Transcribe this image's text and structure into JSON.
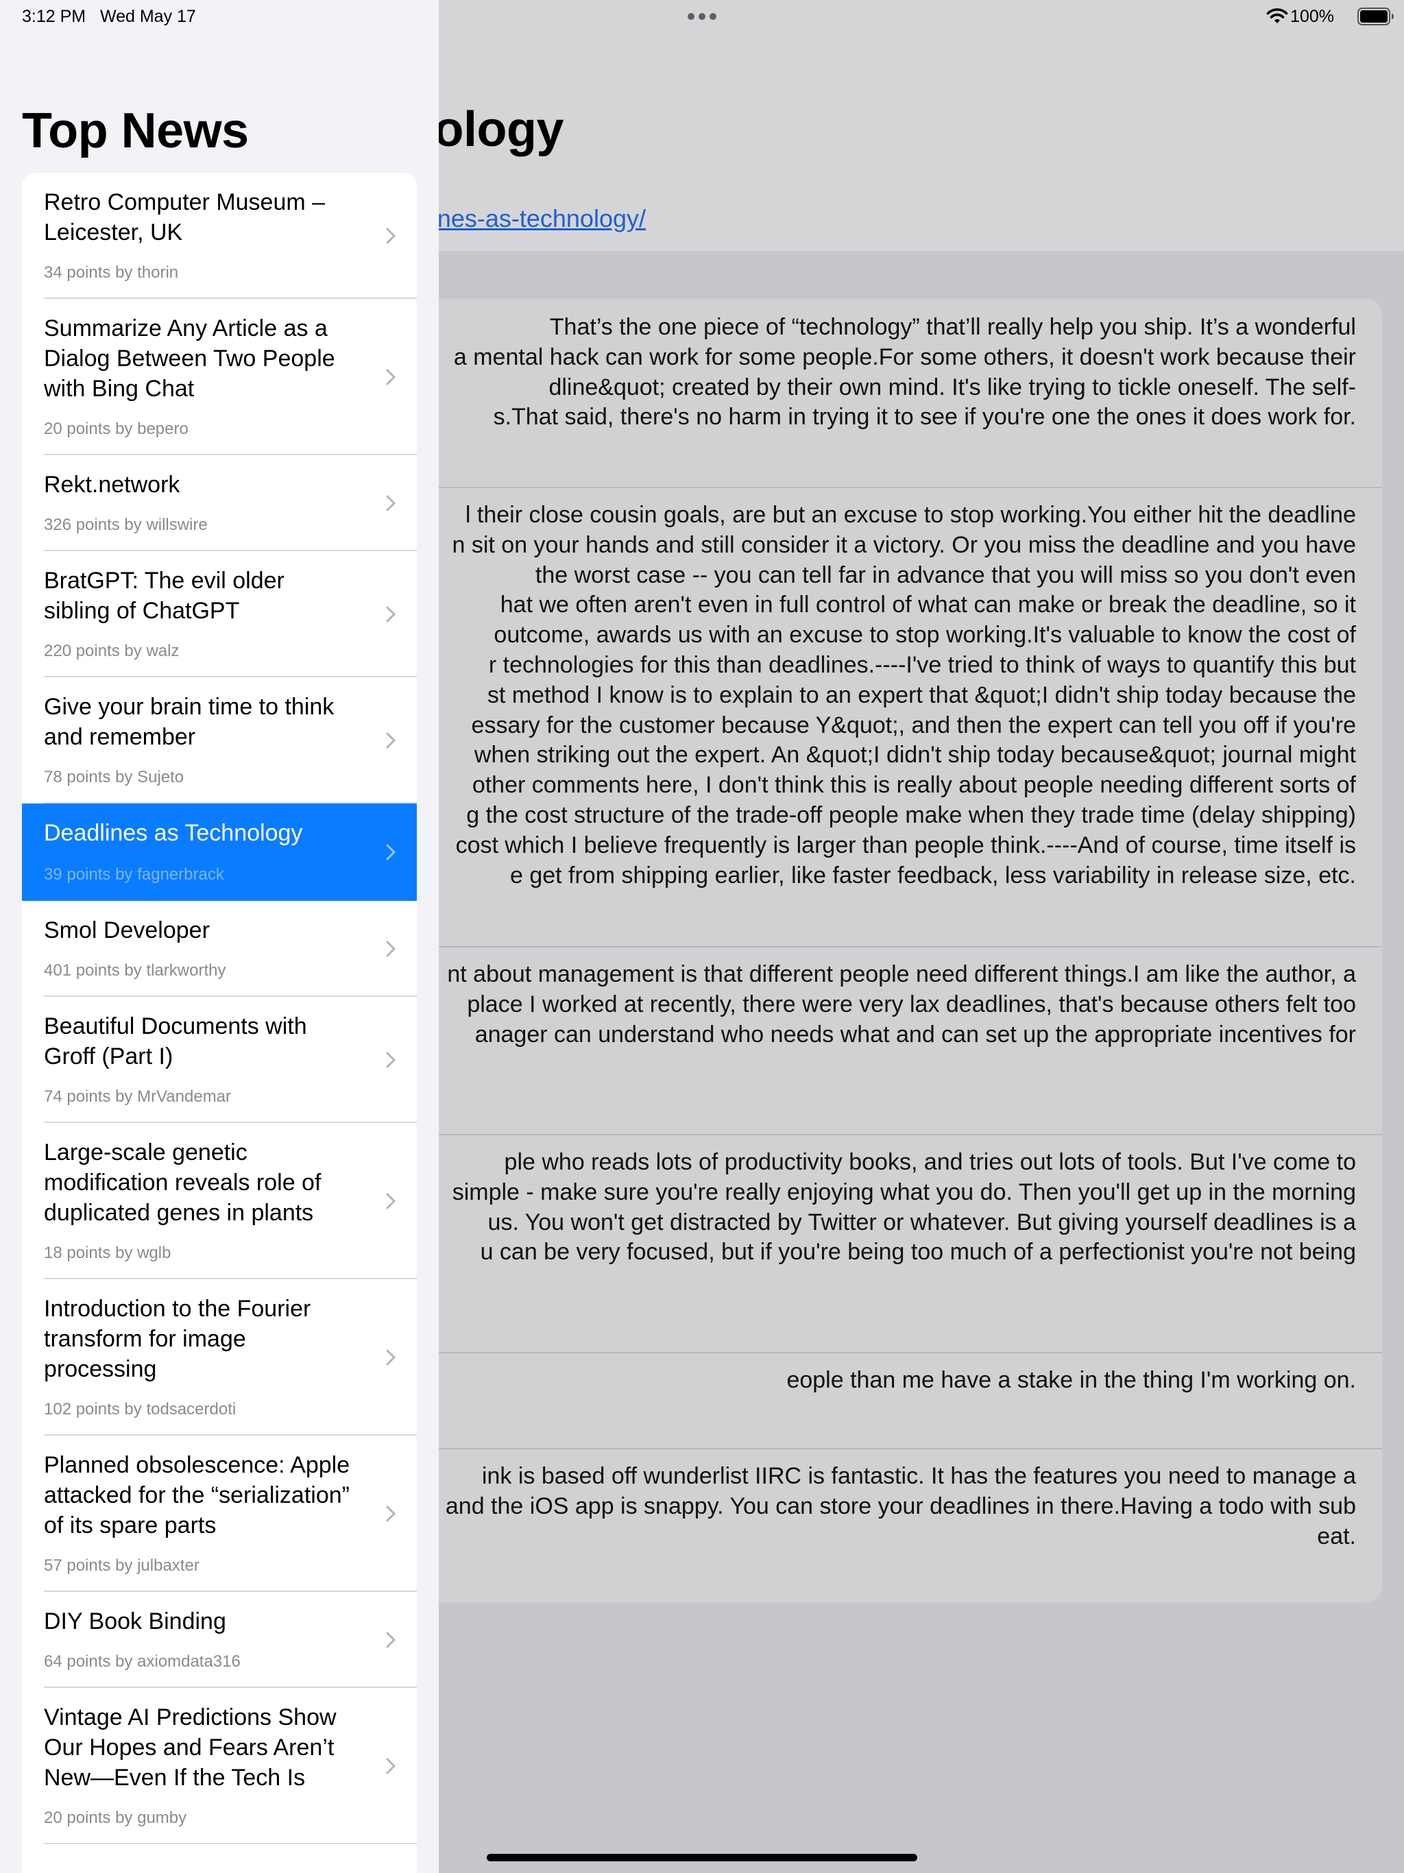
{
  "status_bar": {
    "time": "3:12 PM",
    "date": "Wed May 17",
    "battery": "100%",
    "icons": [
      "more-dots-icon",
      "wifi-icon",
      "battery-icon"
    ]
  },
  "detail": {
    "title_partial": "nology",
    "link_partial": "ines-as-technology/",
    "comments": [
      {
        "lines": [
          "That’s the one piece of “technology” that’ll really help you ship. It’s a wonderful",
          "a mental hack can work for some people.For some others, it doesn't work because their",
          "dline&quot; created by their own mind.  It's like trying to tickle oneself.  The self-",
          "s.That said, there's no harm in trying it to see if you're one the ones it does work for."
        ]
      },
      {
        "lines": [
          "l their close cousin goals, are but an excuse to stop working.You either hit the deadline",
          "n sit on your hands and still consider it a victory. Or you miss the deadline and you have",
          "the worst case -- you can tell far in advance that you will miss so you don't even",
          "hat we often aren't even in full control of what can make or break the deadline, so it",
          "outcome, awards us with an excuse to stop working.It's valuable to know the cost of",
          "r technologies for this than deadlines.----I've tried to think of ways to quantify this but",
          "st method I know is to explain to an expert that &quot;I didn't ship today because the",
          "essary for the customer because Y&quot;, and then the expert can tell you off if you're",
          "when striking out the expert. An &quot;I didn't ship today because&quot; journal might",
          "other comments here, I don't think this is really about people needing different sorts of",
          "g the cost structure of the trade-off people make when they trade time (delay shipping)",
          "cost which I believe frequently is larger than people think.----And of course, time itself is",
          "e get from shipping earlier, like faster feedback, less variability in release size, etc."
        ]
      },
      {
        "lines": [
          "nt about management is that different people need different things.I am like the author, a",
          "place I worked at recently, there were very lax deadlines, that's because others felt too",
          "anager can understand who needs what and can set up the appropriate incentives for"
        ]
      },
      {
        "lines": [
          "ple who reads lots of productivity books, and tries out lots of tools. But I've come to",
          "simple - make sure you're really enjoying what you do. Then you'll get up in the morning",
          "us. You won't get distracted by Twitter or whatever. But giving yourself deadlines is a",
          "u can be very focused, but if you're being too much of a perfectionist you're not being"
        ]
      },
      {
        "lines": [
          "eople than me have a stake in the thing I'm working on."
        ]
      },
      {
        "lines": [
          "ink is based off wunderlist IIRC is fantastic. It has the features you need to manage a",
          "and the iOS app is snappy. You can store your deadlines in there.Having a todo with sub",
          "eat."
        ]
      }
    ]
  },
  "sidebar": {
    "title": "Top News",
    "selected_index": 5,
    "accent_color": "#0a7cff",
    "items": [
      {
        "title": "Retro Computer Museum – Leicester, UK",
        "meta": "34 points by thorin"
      },
      {
        "title": "Summarize Any Article as a Dialog Between Two People with Bing Chat",
        "meta": "20 points by bepero"
      },
      {
        "title": "Rekt.network",
        "meta": "326 points by willswire"
      },
      {
        "title": "BratGPT: The evil older sibling of ChatGPT",
        "meta": "220 points by walz"
      },
      {
        "title": "Give your brain time to think and remember",
        "meta": "78 points by Sujeto"
      },
      {
        "title": "Deadlines as Technology",
        "meta": "39 points by fagnerbrack"
      },
      {
        "title": "Smol Developer",
        "meta": "401 points by tlarkworthy"
      },
      {
        "title": "Beautiful Documents with Groff (Part I)",
        "meta": "74 points by MrVandemar"
      },
      {
        "title": "Large-scale genetic modification reveals role of duplicated genes in plants",
        "meta": "18 points by wglb"
      },
      {
        "title": "Introduction to the Fourier transform for image processing",
        "meta": "102 points by todsacerdoti"
      },
      {
        "title": "Planned obsolescence: Apple attacked for the “serialization” of its spare parts",
        "meta": "57 points by julbaxter"
      },
      {
        "title": "DIY Book Binding",
        "meta": "64 points by axiomdata316"
      },
      {
        "title": "Vintage AI Predictions Show Our Hopes and Fears Aren’t New—Even If the Tech Is",
        "meta": "20 points by gumby"
      }
    ]
  }
}
